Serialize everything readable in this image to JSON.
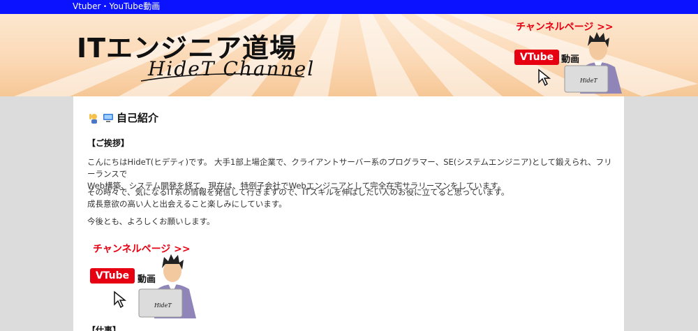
{
  "topbar": {
    "link": "Vtuber・YouTube動画"
  },
  "header": {
    "logo_main": "ITエンジニア道場",
    "logo_sub": "HideT Channel",
    "banner_link": "チャンネルページ >>",
    "banner_badge": "VTube",
    "banner_badge_suffix": "動画",
    "laptop_text": "HideT"
  },
  "main": {
    "section_title": "自己紹介",
    "greeting_heading": "【ご挨拶】",
    "para1_line1": "こんにちはHideT(ヒデティ)です。 大手1部上場企業で、クライアントサーバー系のプログラマー、SE(システムエンジニア)として鍛えられ、フリーランスで",
    "para1_line2": "Web構築、システム開発を経て、現在は、特例子会社でWebエンジニアとして完全在宅サラリーマンをしています。",
    "para2_line1": "その時々で、気になるIT系の情報を発信して行きますので、ITスキルを伸ばしたい人のお役に立てると思っています。",
    "para2_line2": "成長意欲の高い人と出会えること楽しみにしています。",
    "para3": "今後とも、よろしくお願いします。",
    "banner_link": "チャンネルページ >>",
    "banner_badge": "VTube",
    "banner_badge_suffix": "動画",
    "laptop_text": "HideT",
    "next_heading_partial": "【仕事】"
  },
  "colors": {
    "topbar": "#0a12ff",
    "accent_red": "#e60012",
    "page_bg": "#dcdcdc"
  }
}
